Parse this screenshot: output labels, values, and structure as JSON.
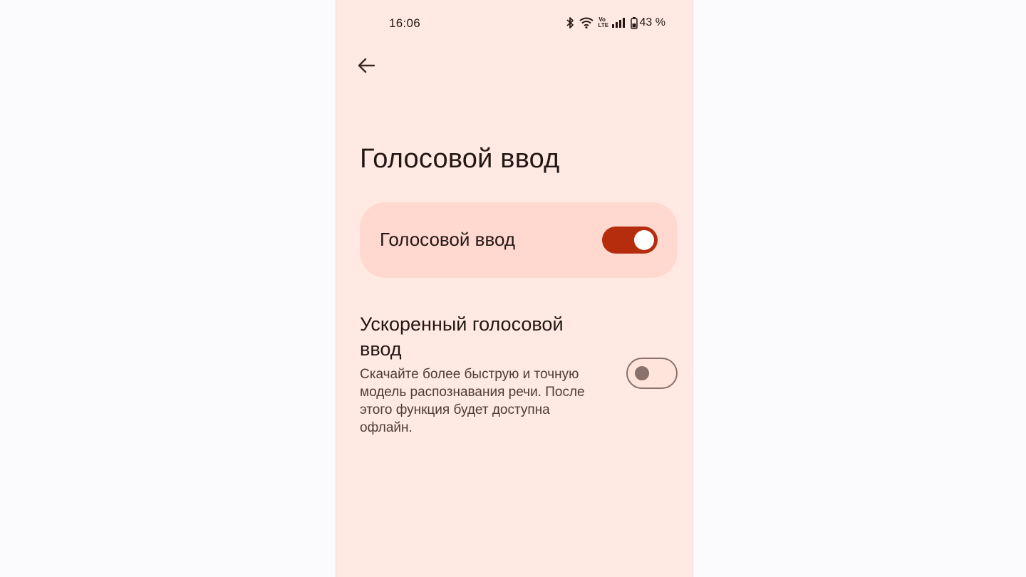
{
  "status_bar": {
    "time": "16:06",
    "volte_label_top": "Vo",
    "volte_label_bottom": "LTE",
    "battery_percent": "43 %",
    "icons": [
      "bluetooth-icon",
      "wifi-icon",
      "volte-icon",
      "signal-icon",
      "battery-icon"
    ]
  },
  "header": {
    "back_icon": "arrow-left-icon"
  },
  "page": {
    "title": "Голосовой ввод"
  },
  "settings": {
    "voice_input": {
      "label": "Голосовой ввод",
      "enabled": true,
      "accent_color": "#b52d0d"
    },
    "fast_voice_input": {
      "title": "Ускоренный голосовой ввод",
      "description": "Скачайте более быструю и точную модель распознавания речи. После этого функция будет доступна офлайн.",
      "enabled": false
    }
  },
  "colors": {
    "background": "#ffe9e2",
    "card": "#ffd9cf",
    "switch_on": "#b52d0d",
    "switch_off_outline": "#8a716b"
  }
}
